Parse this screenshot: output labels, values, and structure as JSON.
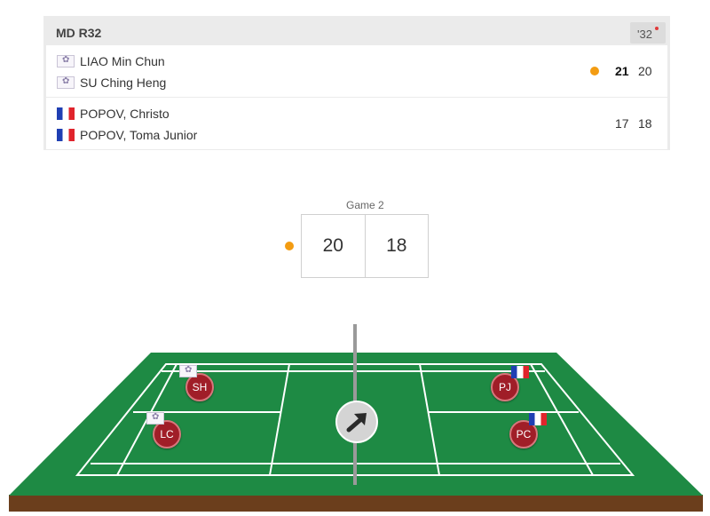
{
  "match": {
    "round": "MD R32",
    "time": "'32",
    "teams": [
      {
        "players": [
          {
            "name": "LIAO Min Chun",
            "flag": "tpe-flag"
          },
          {
            "name": "SU Ching Heng",
            "flag": "tpe-flag"
          }
        ],
        "serving": true,
        "scores": [
          "21",
          "20"
        ]
      },
      {
        "players": [
          {
            "name": "POPOV, Christo",
            "flag": "fra-flag"
          },
          {
            "name": "POPOV, Toma Junior",
            "flag": "fra-flag"
          }
        ],
        "serving": false,
        "scores": [
          "17",
          "18"
        ]
      }
    ]
  },
  "current_game": {
    "label": "Game 2",
    "score_a": "20",
    "score_b": "18"
  },
  "court": {
    "players": [
      {
        "initials": "SH",
        "flag": "tpe-flag"
      },
      {
        "initials": "LC",
        "flag": "tpe-flag"
      },
      {
        "initials": "PJ",
        "flag": "fra-flag"
      },
      {
        "initials": "PC",
        "flag": "fra-flag"
      }
    ],
    "shuttle_icon": "arrow-up-right-icon"
  },
  "colors": {
    "court_green": "#1e8a44",
    "court_base": "#6b3e1c",
    "serve_dot": "#f39c12",
    "player_marker": "#a01e28"
  }
}
